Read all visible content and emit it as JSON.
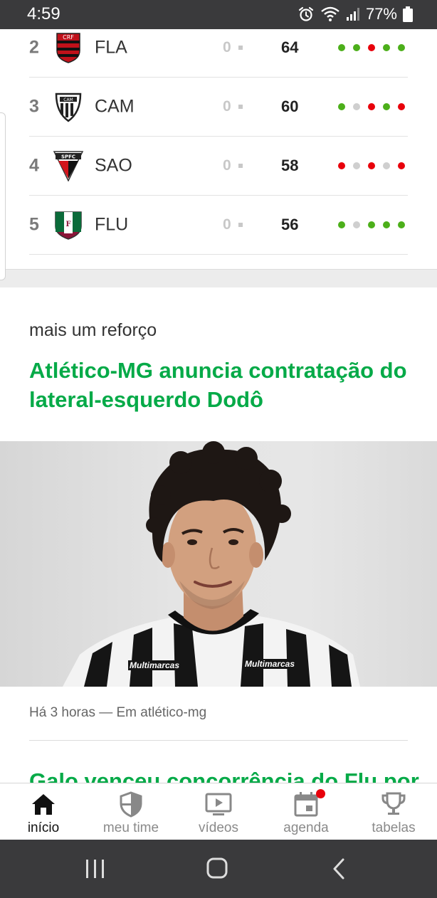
{
  "status_bar": {
    "time": "4:59",
    "battery": "77%"
  },
  "standings": {
    "rows": [
      {
        "pos": "2",
        "abbr": "FLA",
        "var": "0",
        "pts": "64",
        "form": [
          "#4caf1a",
          "#4caf1a",
          "#e8000b",
          "#4caf1a",
          "#4caf1a"
        ]
      },
      {
        "pos": "3",
        "abbr": "CAM",
        "var": "0",
        "pts": "60",
        "form": [
          "#4caf1a",
          "#cfcfcf",
          "#e8000b",
          "#4caf1a",
          "#e8000b"
        ]
      },
      {
        "pos": "4",
        "abbr": "SAO",
        "var": "0",
        "pts": "58",
        "form": [
          "#e8000b",
          "#cfcfcf",
          "#e8000b",
          "#cfcfcf",
          "#e8000b"
        ]
      },
      {
        "pos": "5",
        "abbr": "FLU",
        "var": "0",
        "pts": "56",
        "form": [
          "#4caf1a",
          "#cfcfcf",
          "#4caf1a",
          "#4caf1a",
          "#4caf1a"
        ]
      }
    ]
  },
  "news": {
    "kicker": "mais um reforço",
    "headline": "Atlético-MG anuncia contratação do lateral-esquerdo Dodô",
    "meta": "Há 3 horas — Em atlético-mg",
    "next_headline": "Galo venceu concorrência do Flu por",
    "jersey_sponsor": "Multimarcas"
  },
  "bottom_nav": {
    "items": [
      {
        "label": "início",
        "icon": "home-icon",
        "active": true
      },
      {
        "label": "meu time",
        "icon": "shield-icon",
        "active": false
      },
      {
        "label": "vídeos",
        "icon": "video-icon",
        "active": false
      },
      {
        "label": "agenda",
        "icon": "calendar-icon",
        "active": false,
        "badge": true
      },
      {
        "label": "tabelas",
        "icon": "trophy-icon",
        "active": false
      }
    ]
  },
  "colors": {
    "accent_green": "#06aa48",
    "win": "#4caf1a",
    "loss": "#e8000b",
    "draw": "#cfcfcf"
  }
}
